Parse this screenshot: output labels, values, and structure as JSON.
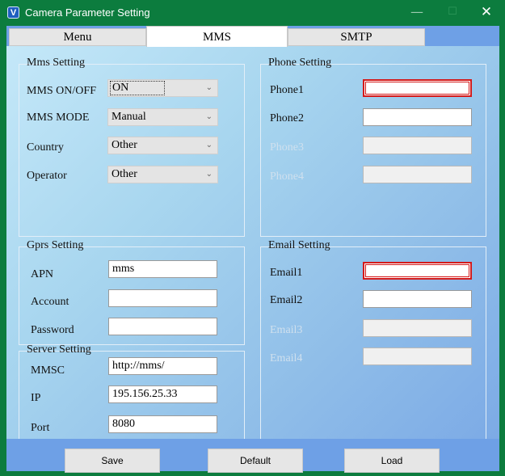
{
  "window": {
    "title": "Camera Parameter Setting",
    "minimize_glyph": "—",
    "maximize_glyph": "☐",
    "close_glyph": "✕",
    "icon_letter": "V"
  },
  "tabs": [
    {
      "label": "Menu",
      "active": false
    },
    {
      "label": "MMS",
      "active": true
    },
    {
      "label": "SMTP",
      "active": false
    }
  ],
  "mms_setting": {
    "title": "Mms Setting",
    "rows": [
      {
        "label": "MMS ON/OFF",
        "value": "ON"
      },
      {
        "label": "MMS MODE",
        "value": "Manual"
      },
      {
        "label": "Country",
        "value": "Other"
      },
      {
        "label": "Operator",
        "value": "Other"
      }
    ],
    "arrow": "⌄"
  },
  "phone_setting": {
    "title": "Phone Setting",
    "rows": [
      {
        "label": "Phone1",
        "value": "",
        "state": "error"
      },
      {
        "label": "Phone2",
        "value": "",
        "state": "normal"
      },
      {
        "label": "Phone3",
        "value": "",
        "state": "disabled"
      },
      {
        "label": "Phone4",
        "value": "",
        "state": "disabled"
      }
    ]
  },
  "gprs_setting": {
    "title": "Gprs Setting",
    "rows": [
      {
        "label": "APN",
        "value": "mms"
      },
      {
        "label": "Account",
        "value": ""
      },
      {
        "label": "Password",
        "value": ""
      }
    ]
  },
  "server_setting": {
    "title": "Server Setting",
    "rows": [
      {
        "label": "MMSC",
        "value": "http://mms/"
      },
      {
        "label": "IP",
        "value": "195.156.25.33"
      },
      {
        "label": "Port",
        "value": "8080"
      }
    ]
  },
  "email_setting": {
    "title": "Email Setting",
    "rows": [
      {
        "label": "Email1",
        "value": "",
        "state": "error"
      },
      {
        "label": "Email2",
        "value": "",
        "state": "normal"
      },
      {
        "label": "Email3",
        "value": "",
        "state": "disabled"
      },
      {
        "label": "Email4",
        "value": "",
        "state": "disabled"
      }
    ]
  },
  "buttons": {
    "save": "Save",
    "default": "Default",
    "load": "Load"
  },
  "colors": {
    "title_bar": "#0c7c3e",
    "error_border": "#d41a1a",
    "frame_blue": "#6ea0e6"
  }
}
